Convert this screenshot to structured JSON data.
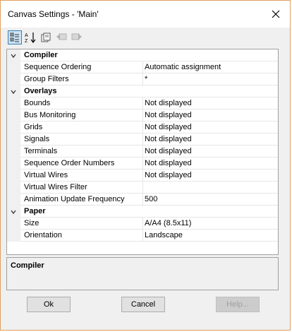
{
  "window": {
    "title": "Canvas Settings - 'Main'"
  },
  "toolbar": {
    "buttons": [
      {
        "icon": "categorized-icon",
        "active": true
      },
      {
        "icon": "alphabetical-sort-icon",
        "active": false
      },
      {
        "icon": "property-pages-icon",
        "active": false
      },
      {
        "icon": "back-icon",
        "active": false
      },
      {
        "icon": "forward-icon",
        "active": false
      }
    ]
  },
  "grid": {
    "categories": [
      {
        "label": "Compiler",
        "properties": [
          {
            "name": "Sequence Ordering",
            "value": "Automatic assignment"
          },
          {
            "name": "Group Filters",
            "value": "*"
          }
        ]
      },
      {
        "label": "Overlays",
        "properties": [
          {
            "name": "Bounds",
            "value": "Not displayed"
          },
          {
            "name": "Bus Monitoring",
            "value": "Not displayed"
          },
          {
            "name": "Grids",
            "value": "Not displayed"
          },
          {
            "name": "Signals",
            "value": "Not displayed"
          },
          {
            "name": "Terminals",
            "value": "Not displayed"
          },
          {
            "name": "Sequence Order Numbers",
            "value": "Not displayed"
          },
          {
            "name": "Virtual Wires",
            "value": "Not displayed"
          },
          {
            "name": "Virtual Wires Filter",
            "value": ""
          },
          {
            "name": "Animation Update Frequency",
            "value": "500"
          }
        ]
      },
      {
        "label": "Paper",
        "properties": [
          {
            "name": "Size",
            "value": "A/A4 (8.5x11)"
          },
          {
            "name": "Orientation",
            "value": "Landscape"
          }
        ]
      }
    ]
  },
  "description": {
    "title": "Compiler"
  },
  "footer": {
    "ok_label": "Ok",
    "cancel_label": "Cancel",
    "help_label": "Help..."
  },
  "colors": {
    "border_accent": "#e0a060",
    "toolbar_active": "#cce4f7"
  }
}
